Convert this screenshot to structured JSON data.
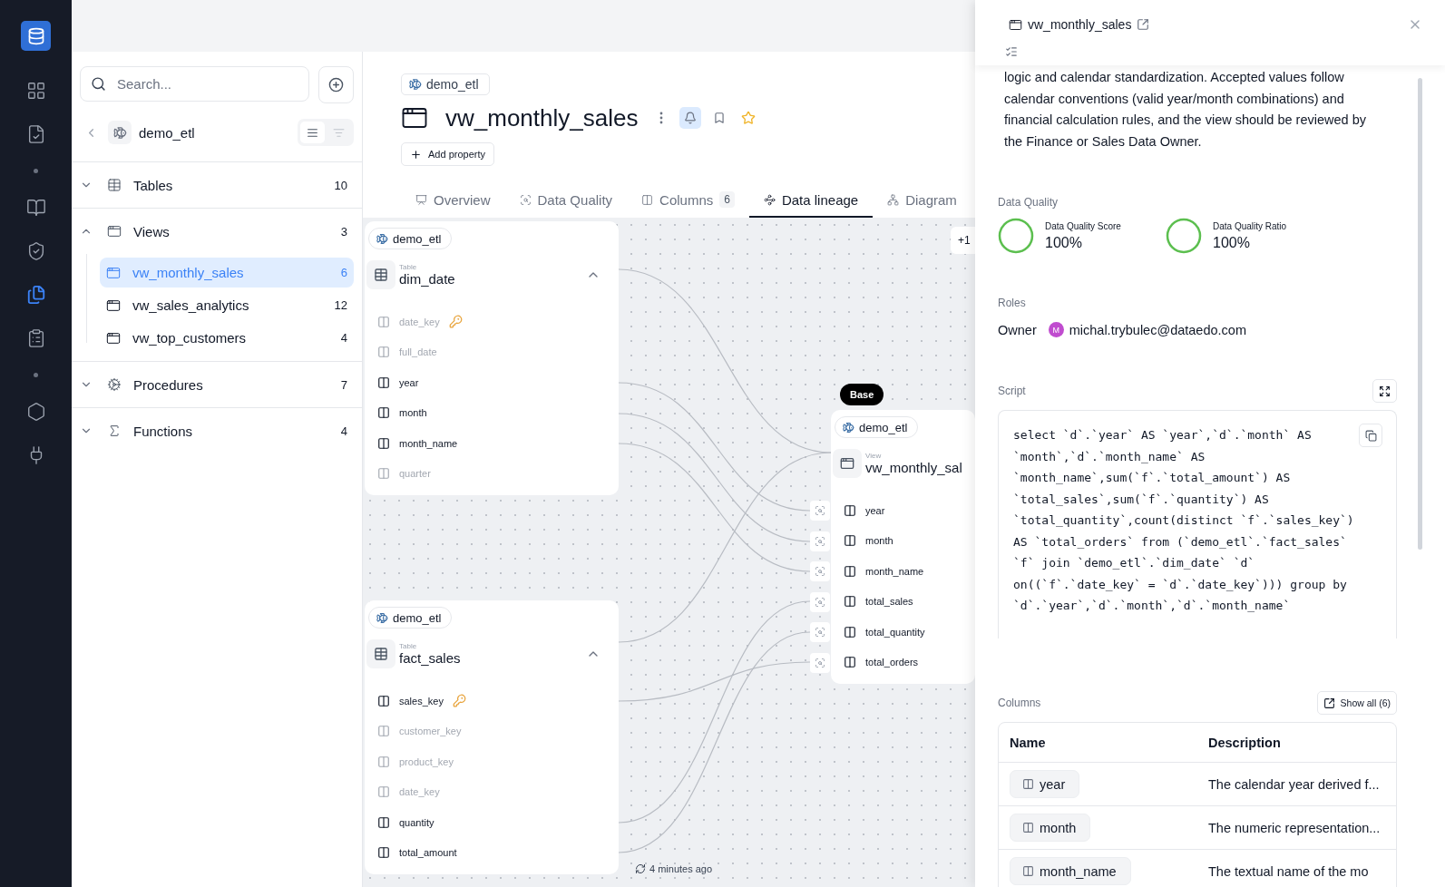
{
  "nav_rail": [
    {
      "kind": "grid",
      "selected": false
    },
    {
      "kind": "document",
      "selected": false
    },
    {
      "kind": "book",
      "selected": false
    },
    {
      "kind": "shield",
      "selected": false
    },
    {
      "kind": "folders",
      "selected": true
    },
    {
      "kind": "clipboard",
      "selected": false
    },
    {
      "kind": "hexagon",
      "selected": false
    },
    {
      "kind": "plug",
      "selected": false
    }
  ],
  "explorer": {
    "search": {
      "placeholder": "Search..."
    },
    "source": "demo_etl",
    "view_modes": [
      {
        "kind": "list",
        "selected": true
      },
      {
        "kind": "tree",
        "selected": false
      }
    ],
    "groups": [
      {
        "kind": "table",
        "label": "Tables",
        "count": "10",
        "expanded": false
      },
      {
        "kind": "view",
        "label": "Views",
        "count": "3",
        "expanded": true,
        "children": [
          {
            "label": "vw_monthly_sales",
            "count": "6",
            "selected": true
          },
          {
            "label": "vw_sales_analytics",
            "count": "12",
            "selected": false
          },
          {
            "label": "vw_top_customers",
            "count": "4",
            "selected": false
          }
        ]
      },
      {
        "kind": "procedure",
        "label": "Procedures",
        "count": "7",
        "expanded": false
      },
      {
        "kind": "function",
        "label": "Functions",
        "count": "4",
        "expanded": false
      }
    ]
  },
  "header": {
    "breadcrumb": "demo_etl",
    "title": "vw_monthly_sales",
    "notifications_on": true,
    "add_property": "Add property"
  },
  "tabs": [
    {
      "kind": "overview",
      "label": "Overview",
      "selected": false
    },
    {
      "kind": "quality",
      "label": "Data Quality",
      "selected": false
    },
    {
      "kind": "columns",
      "label": "Columns",
      "count": "6",
      "selected": false
    },
    {
      "kind": "lineage",
      "label": "Data lineage",
      "selected": true
    },
    {
      "kind": "diagram",
      "label": "Diagram",
      "selected": false
    }
  ],
  "lineage": {
    "more_chip": "+1",
    "timestamp": "4 minutes ago",
    "nodes": [
      {
        "source": "demo_etl",
        "type": "Table",
        "name": "dim_date",
        "expanded": true,
        "columns": [
          {
            "name": "date_key",
            "linked": false,
            "primary_key": true
          },
          {
            "name": "full_date",
            "linked": false,
            "primary_key": false
          },
          {
            "name": "year",
            "linked": true,
            "primary_key": false
          },
          {
            "name": "month",
            "linked": true,
            "primary_key": false
          },
          {
            "name": "month_name",
            "linked": true,
            "primary_key": false
          },
          {
            "name": "quarter",
            "linked": false,
            "primary_key": false
          }
        ]
      },
      {
        "source": "demo_etl",
        "type": "Table",
        "name": "fact_sales",
        "expanded": true,
        "columns": [
          {
            "name": "sales_key",
            "linked": true,
            "primary_key": true
          },
          {
            "name": "customer_key",
            "linked": false,
            "primary_key": false
          },
          {
            "name": "product_key",
            "linked": false,
            "primary_key": false
          },
          {
            "name": "date_key",
            "linked": false,
            "primary_key": false
          },
          {
            "name": "quantity",
            "linked": true,
            "primary_key": false
          },
          {
            "name": "total_amount",
            "linked": true,
            "primary_key": false
          }
        ]
      }
    ],
    "base": {
      "badge": "Base",
      "source": "demo_etl",
      "type": "View",
      "name": "vw_monthly_sal",
      "columns": [
        {
          "name": "year"
        },
        {
          "name": "month"
        },
        {
          "name": "month_name"
        },
        {
          "name": "total_sales"
        },
        {
          "name": "total_quantity"
        },
        {
          "name": "total_orders"
        }
      ]
    }
  },
  "details": {
    "title": "vw_monthly_sales",
    "description": "logic and calendar standardization. Accepted values follow calendar conventions (valid year/month combinations) and financial calculation rules, and the view should be reviewed by the Finance or Sales Data Owner.",
    "quality_label": "Data Quality",
    "quality": [
      {
        "label": "Data Quality Score",
        "value": "100%",
        "level": 1
      },
      {
        "label": "Data Quality Ratio",
        "value": "100%",
        "level": 1
      }
    ],
    "roles_label": "Roles",
    "roles": [
      {
        "role": "Owner",
        "initial": "M",
        "user": "michal.trybulec@dataedo.com"
      }
    ],
    "script_label": "Script",
    "script": "select `d`.`year` AS `year`,`d`.`month` AS `month`,`d`.`month_name` AS `month_name`,sum(`f`.`total_amount`) AS `total_sales`,sum(`f`.`quantity`) AS `total_quantity`,count(distinct `f`.`sales_key`) AS `total_orders` from (`demo_etl`.`fact_sales` `f` join `demo_etl`.`dim_date` `d` on((`f`.`date_key` = `d`.`date_key`))) group by `d`.`year`,`d`.`month`,`d`.`month_name`",
    "columns_label": "Columns",
    "show_all": "Show all (6)",
    "table": {
      "columns": [
        "Name",
        "Description"
      ],
      "rows": [
        {
          "name": "year",
          "description": "The calendar year derived f..."
        },
        {
          "name": "month",
          "description": "The numeric representation..."
        },
        {
          "name": "month_name",
          "description": "The textual name of the mo"
        }
      ]
    }
  }
}
